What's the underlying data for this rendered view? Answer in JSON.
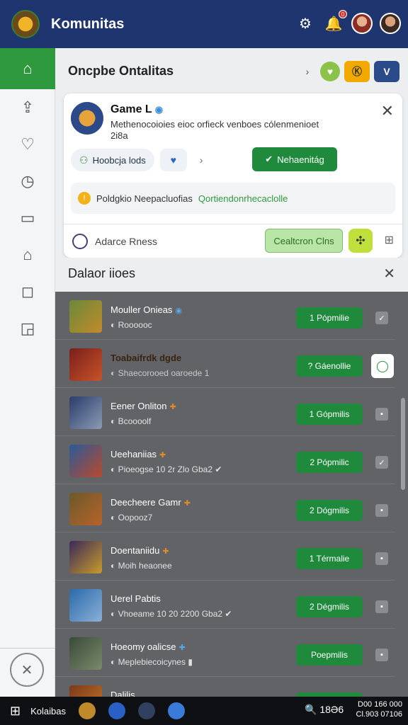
{
  "header": {
    "title": "Komunitas",
    "notification_badge": "0",
    "icons": [
      "gear-icon",
      "bell-icon",
      "avatar",
      "avatar"
    ]
  },
  "sidebar": {
    "items": [
      "home-icon",
      "upload-icon",
      "heart-icon",
      "clock-icon",
      "folder-icon",
      "bag-icon",
      "chat-icon",
      "image-icon"
    ],
    "bottom": "✕"
  },
  "main": {
    "heading": "Oncpbe Ontalitas",
    "tools": {
      "arrow": "›",
      "yellow": "Ⓚ",
      "blue": "V"
    }
  },
  "card": {
    "title": "Game L",
    "description": "Methenocoioies eioc orfieck venboes cólenmenioet   2i8a",
    "chip_label": "Hoobcja lods",
    "primary_button": "Nehaenitág",
    "notice_text": "Poldgkio Neepacluofias",
    "notice_link": "Qortiendonrhecaclolle",
    "foot_label": "Adarce Rness",
    "foot_button": "Cealtcron Clns"
  },
  "section": {
    "title": "Dalaor iioes"
  },
  "list": [
    {
      "name": "Mouller Onieas",
      "sub": "Roooooc",
      "button": "1 Pópmilie",
      "mark": "blue"
    },
    {
      "name": "Toabaifrdk dgde",
      "sub": "Shaecorooed oaroede 1",
      "button": "? Gáenollie",
      "mark": ""
    },
    {
      "name": "Eener Onliton",
      "sub": "Bcoooolf",
      "button": "1 Gópmilis",
      "mark": "orange"
    },
    {
      "name": "Ueehaniias",
      "sub": "Pioeogse 10 2r Zlo Gba2",
      "button": "2 Pópmilic",
      "mark": "orange"
    },
    {
      "name": "Deecheere Gamr",
      "sub": "Oopooz7",
      "button": "2 Dógmilis",
      "mark": "orange"
    },
    {
      "name": "Doentaniidu",
      "sub": "Moih heaonee",
      "button": "1 Térmalie",
      "mark": "orange"
    },
    {
      "name": "Uerel Pabtis",
      "sub": "Vhoeame 10 20 2200 Gba2",
      "button": "2 Dégmilis",
      "mark": ""
    },
    {
      "name": "Hoeomy oalicse",
      "sub": "Meplebiecoicynes",
      "button": "Poepmilis",
      "mark": "blue"
    },
    {
      "name": "Dalilis",
      "sub": "",
      "button": "",
      "mark": ""
    }
  ],
  "taskbar": {
    "label": "Kolaibas",
    "search": "18Ə6",
    "time": "D00 166 000",
    "date": "Cl.903 07106"
  }
}
